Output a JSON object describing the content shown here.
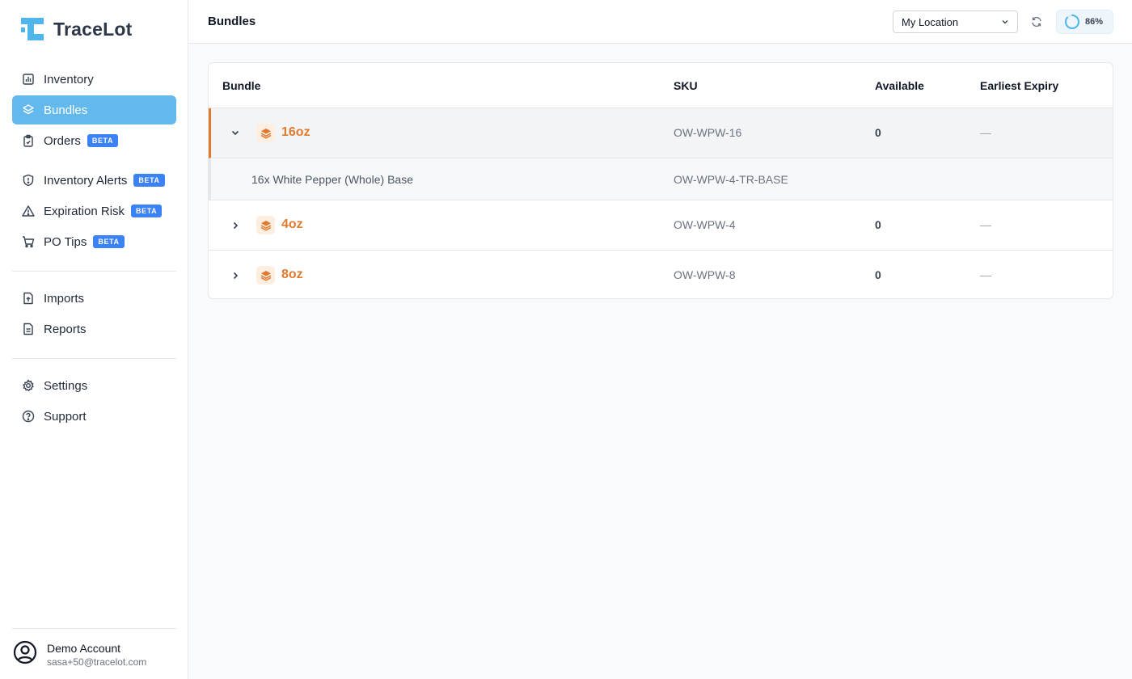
{
  "app": {
    "name": "TraceLot"
  },
  "sidebar": {
    "items": [
      {
        "label": "Inventory",
        "icon": "chart-icon",
        "active": false
      },
      {
        "label": "Bundles",
        "icon": "layers-icon",
        "active": true
      },
      {
        "label": "Orders",
        "icon": "clipboard-icon",
        "badge": "BETA"
      },
      {
        "label": "Inventory Alerts",
        "icon": "shield-alert-icon",
        "badge": "BETA"
      },
      {
        "label": "Expiration Risk",
        "icon": "warning-icon",
        "badge": "BETA"
      },
      {
        "label": "PO Tips",
        "icon": "cart-icon",
        "badge": "BETA"
      },
      {
        "label": "Imports",
        "icon": "file-upload-icon"
      },
      {
        "label": "Reports",
        "icon": "file-text-icon"
      },
      {
        "label": "Settings",
        "icon": "gear-icon"
      },
      {
        "label": "Support",
        "icon": "help-icon"
      }
    ],
    "account": {
      "name": "Demo Account",
      "email": "sasa+50@tracelot.com"
    }
  },
  "header": {
    "title": "Bundles",
    "location": "My Location",
    "progress_label": "86%",
    "progress_value": 0.86
  },
  "table": {
    "columns": {
      "bundle": "Bundle",
      "sku": "SKU",
      "available": "Available",
      "expiry": "Earliest Expiry"
    },
    "rows": [
      {
        "name": "16oz",
        "sku": "OW-WPW-16",
        "available": "0",
        "expiry": "—",
        "expanded": true,
        "child": {
          "name": "16x White Pepper (Whole) Base",
          "sku": "OW-WPW-4-TR-BASE"
        }
      },
      {
        "name": "4oz",
        "sku": "OW-WPW-4",
        "available": "0",
        "expiry": "—",
        "expanded": false
      },
      {
        "name": "8oz",
        "sku": "OW-WPW-8",
        "available": "0",
        "expiry": "—",
        "expanded": false
      }
    ]
  },
  "colors": {
    "accent": "#63b8ee",
    "brand": "#4fb5ea",
    "bundle_orange": "#e07a2e",
    "badge_blue": "#3b82f6"
  }
}
